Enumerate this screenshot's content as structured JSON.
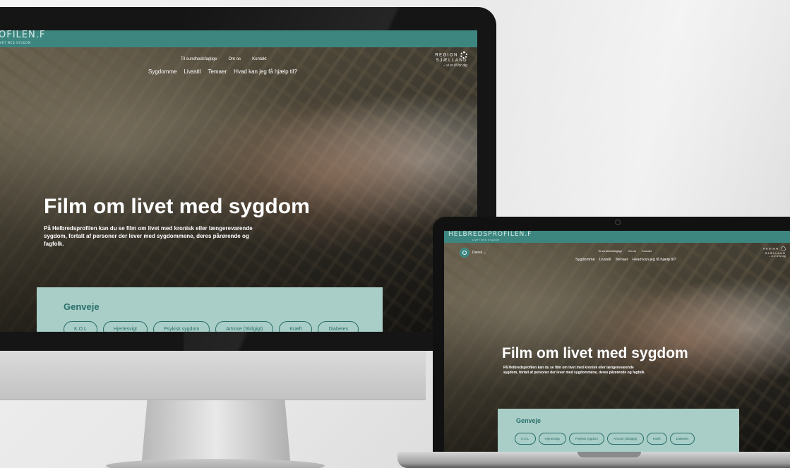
{
  "site": {
    "logo_big": "OFILEN.",
    "logo_big_tag": "IVET MED SYGDOM",
    "logo_small": "HELBREDSPROFILEN.",
    "logo_small_tag": "LIVET MED SYGDOM",
    "logo_mark": "Ḟ",
    "logo_suffix": "☉"
  },
  "nav_top": [
    "Til sundhedsfaglige",
    "Om os",
    "Kontakt"
  ],
  "nav_main": [
    "Sygdomme",
    "Livsstil",
    "Temaer",
    "Hvad kan jeg få hjælp til?"
  ],
  "region": {
    "line1": "REGION",
    "line2": "SJÆLLAND",
    "tagline": "– vi er til for dig"
  },
  "language": {
    "label": "Dansk",
    "chevron": "⌄"
  },
  "hero": {
    "title": "Film om livet med sygdom",
    "text_big": "På Helbredsprofilen kan du se film om livet med kronisk eller længerevarende sygdom, fortalt af personer der lever med sygdommene, deres pårørende og fagfolk.",
    "text_small": "På Helbredsprofilen kan du se film om livet med kronisk eller længerevarende sygdom, fortalt af personer der lever med sygdommene, deres pårørende og fagfolk."
  },
  "genveje": {
    "title": "Genveje",
    "chips": [
      "K.O.L",
      "Hjertesvigt",
      "Psykisk sygdom",
      "Artrose (Slidgigt)",
      "Kræft",
      "Diabetes"
    ]
  },
  "icons": {
    "search": "search-icon",
    "region_logo": "region-dots-icon"
  },
  "colors": {
    "brand": "#3d8680",
    "panel": "#a9cdc7",
    "panel_text": "#2a6f69"
  }
}
